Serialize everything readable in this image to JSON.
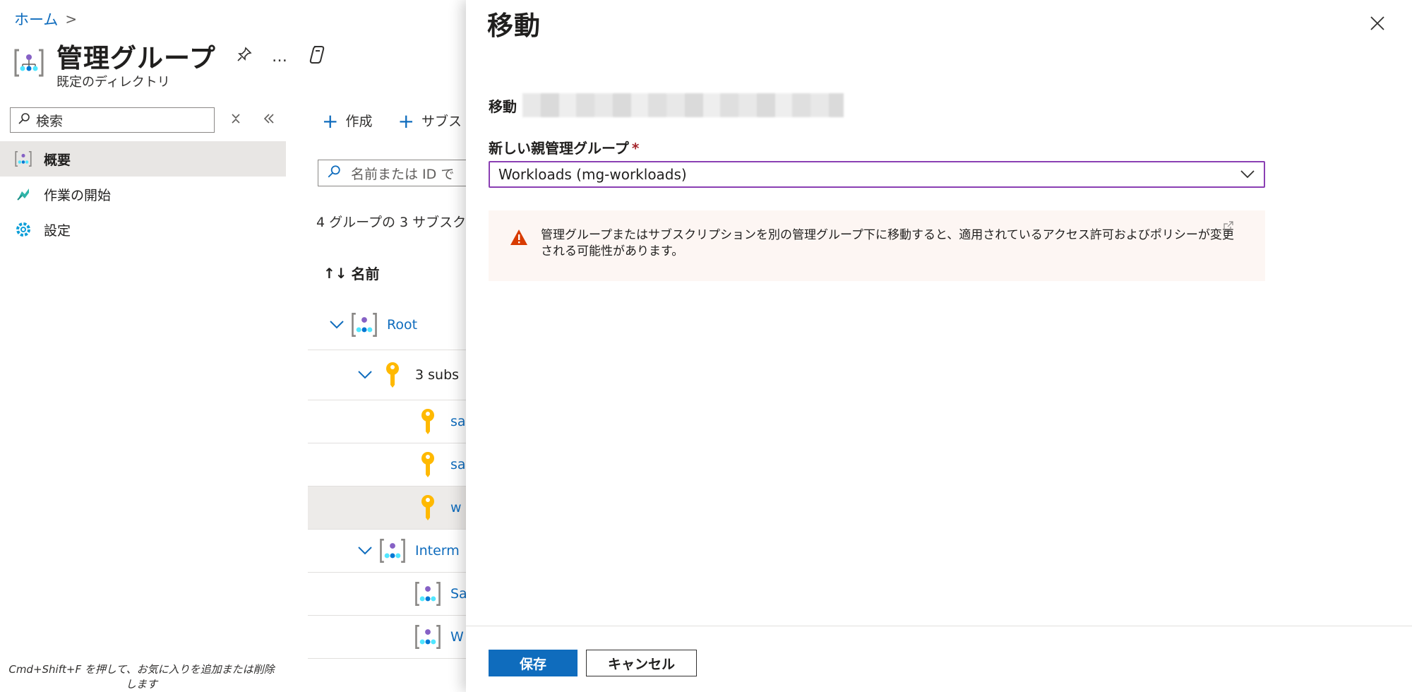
{
  "breadcrumb": {
    "home": "ホーム",
    "separator": ">"
  },
  "blade": {
    "title": "管理グループ",
    "subtitle": "既定のディレクトリ",
    "actions": {
      "pin": "pin-icon",
      "more": "…",
      "copilot": "copilot-icon"
    }
  },
  "sidebar": {
    "search_placeholder": "検索",
    "items": [
      {
        "label": "概要",
        "icon": "management-group-icon",
        "active": true
      },
      {
        "label": "作業の開始",
        "icon": "quickstart-icon",
        "active": false
      },
      {
        "label": "設定",
        "icon": "gear-icon",
        "active": false
      }
    ],
    "footer_hint": "Cmd+Shift+F を押して、お気に入りを追加または削除します"
  },
  "main": {
    "commands": [
      {
        "label": "作成"
      },
      {
        "label": "サブス"
      }
    ],
    "filter_placeholder": "名前または ID で",
    "count_text": "4 グループの 3 サブスク",
    "column_name": "名前",
    "tree": [
      {
        "label": "Root",
        "type": "group",
        "expanded": true
      },
      {
        "label": "3 subs",
        "type": "subscriptions",
        "expanded": true
      },
      {
        "label": "sa",
        "type": "subscription"
      },
      {
        "label": "sa",
        "type": "subscription"
      },
      {
        "label": "w",
        "type": "subscription",
        "selected": true
      },
      {
        "label": "Interm",
        "type": "group",
        "expanded": true
      },
      {
        "label": "Sa",
        "type": "group"
      },
      {
        "label": "W",
        "type": "group"
      }
    ]
  },
  "panel": {
    "title": "移動",
    "move_label": "移動",
    "parent_label": "新しい親管理グループ",
    "required_mark": "*",
    "selected_parent": "Workloads (mg-workloads)",
    "warning_text": "管理グループまたはサブスクリプションを別の管理グループ下に移動すると、適用されているアクセス許可およびポリシーが変更される可能性があります。",
    "save_label": "保存",
    "cancel_label": "キャンセル"
  },
  "colors": {
    "accent": "#0f6cbd",
    "select_border": "#8a3fb3",
    "warning_bg": "#fdf6f3",
    "warning_icon": "#d83b01",
    "required": "#a4262c"
  }
}
